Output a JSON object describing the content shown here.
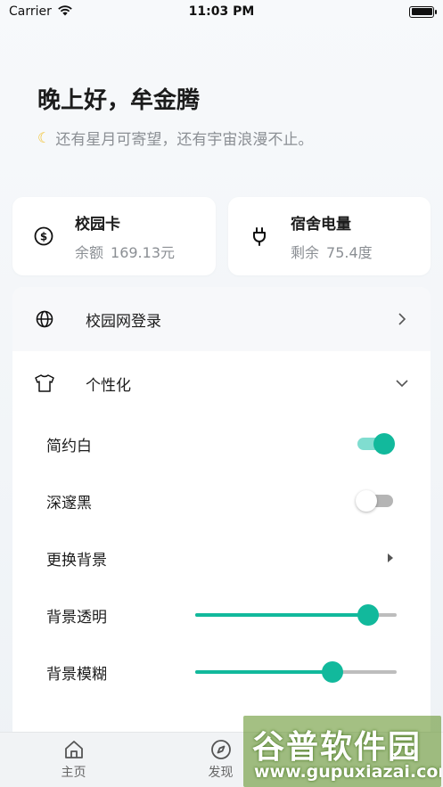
{
  "status_bar": {
    "carrier": "Carrier",
    "time": "11:03 PM"
  },
  "header": {
    "greeting": "晚上好，牟金腾",
    "subtitle": "还有星月可寄望，还有宇宙浪漫不止。"
  },
  "cards": {
    "campus_card": {
      "title": "校园卡",
      "label": "余额",
      "value": "169.13元"
    },
    "dorm_power": {
      "title": "宿舍电量",
      "label": "剩余",
      "value": "75.4度"
    }
  },
  "menu": {
    "campus_network": "校园网登录",
    "personalize": "个性化"
  },
  "settings": {
    "simple_white": {
      "label": "简约白",
      "on": true
    },
    "deep_black": {
      "label": "深邃黑",
      "on": false
    },
    "change_background": {
      "label": "更换背景"
    },
    "background_opacity": {
      "label": "背景透明",
      "value": 0.86
    },
    "background_blur": {
      "label": "背景模糊",
      "value": 0.68
    }
  },
  "tabbar": {
    "home": "主页",
    "discover": "发现"
  },
  "colors": {
    "accent": "#12b99c",
    "accent_light": "#80ddd0",
    "muted_text": "#8b8f94"
  },
  "watermark": {
    "text": "谷普软件园",
    "url": "www.gupuxiazai.com"
  }
}
